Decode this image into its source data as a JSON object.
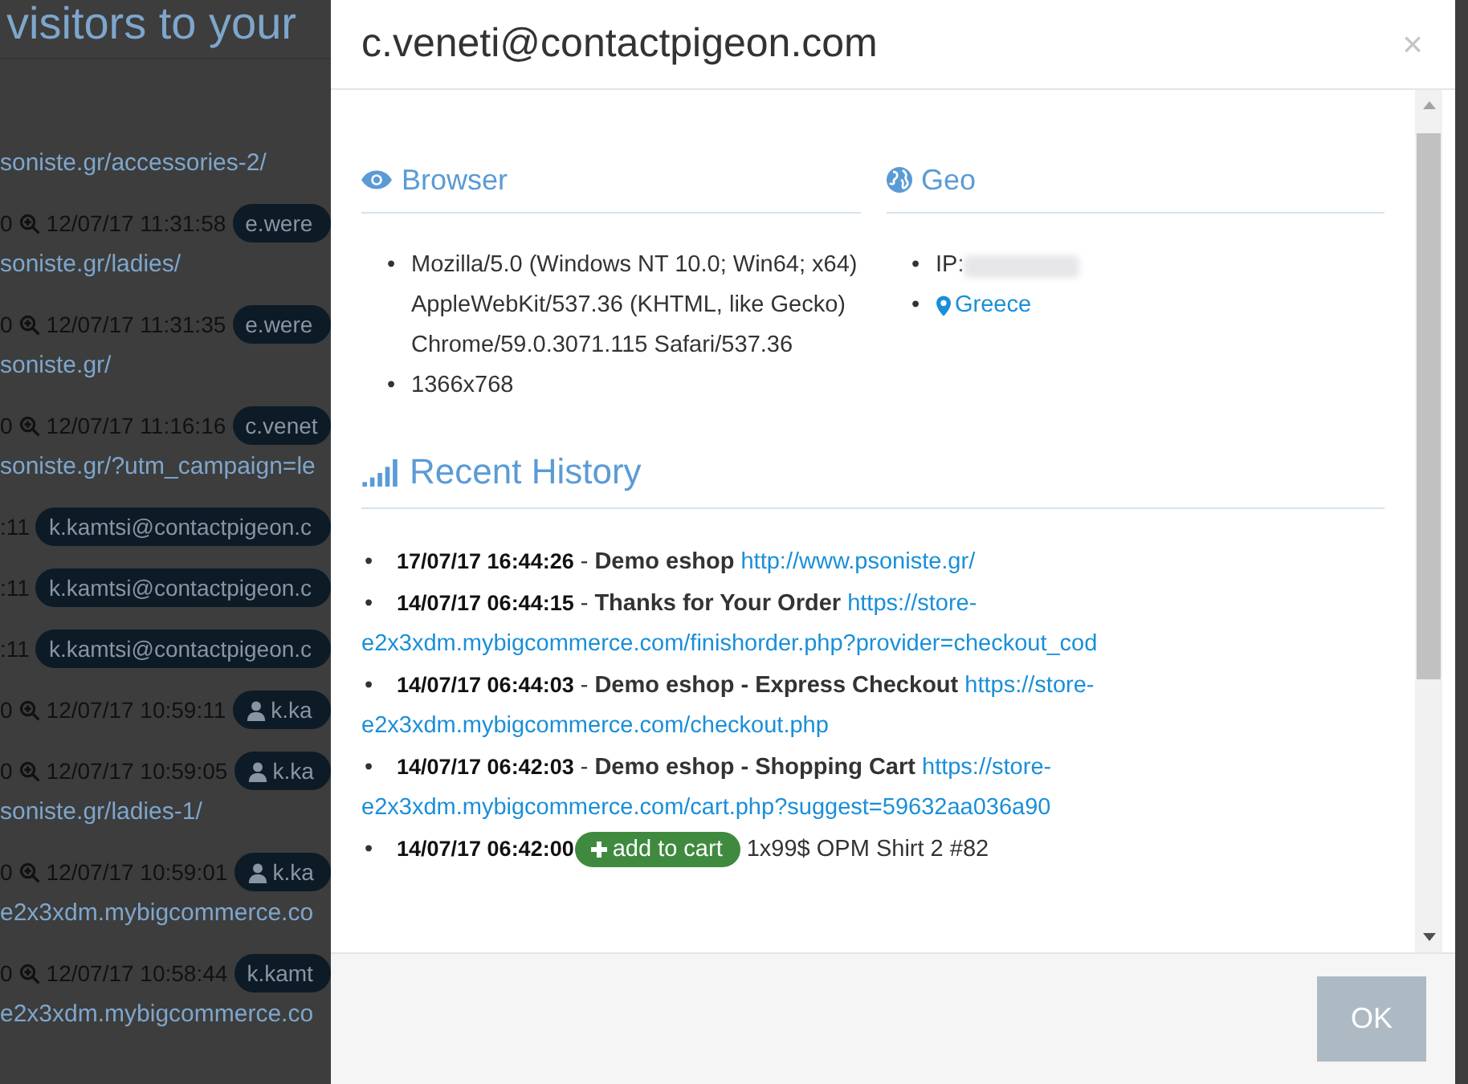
{
  "background": {
    "heading": "visitors to your",
    "rows": [
      {
        "kind": "link",
        "text": "soniste.gr/accessories-2/"
      },
      {
        "kind": "visit",
        "prefix": "0",
        "time": "12/07/17 11:31:58",
        "user": "e.were"
      },
      {
        "kind": "link",
        "text": "soniste.gr/ladies/"
      },
      {
        "kind": "visit",
        "prefix": "0",
        "time": "12/07/17 11:31:35",
        "user": "e.were"
      },
      {
        "kind": "link",
        "text": "soniste.gr/"
      },
      {
        "kind": "visit",
        "prefix": "0",
        "time": "12/07/17 11:16:16",
        "user": "c.venet"
      },
      {
        "kind": "link",
        "text": "soniste.gr/?utm_campaign=le"
      },
      {
        "kind": "user",
        "prefix": ":11",
        "user": "k.kamtsi@contactpigeon.c"
      },
      {
        "kind": "user",
        "prefix": ":11",
        "user": "k.kamtsi@contactpigeon.c"
      },
      {
        "kind": "user",
        "prefix": ":11",
        "user": "k.kamtsi@contactpigeon.c"
      },
      {
        "kind": "visit_icon",
        "prefix": "0",
        "time": "12/07/17 10:59:11",
        "user": "k.ka"
      },
      {
        "kind": "visit_icon",
        "prefix": "0",
        "time": "12/07/17 10:59:05",
        "user": "k.ka"
      },
      {
        "kind": "link",
        "text": "soniste.gr/ladies-1/"
      },
      {
        "kind": "visit_icon",
        "prefix": "0",
        "time": "12/07/17 10:59:01",
        "user": "k.ka"
      },
      {
        "kind": "link",
        "text": "e2x3xdm.mybigcommerce.co"
      },
      {
        "kind": "visit",
        "prefix": "0",
        "time": "12/07/17 10:58:44",
        "user": "k.kamt"
      },
      {
        "kind": "link",
        "text": "e2x3xdm.mybigcommerce.co"
      }
    ]
  },
  "modal": {
    "title": "c.veneti@contactpigeon.com",
    "close": "×",
    "browser": {
      "heading": "Browser",
      "items": [
        {
          "bullet": "•",
          "text": "Mozilla/5.0 (Windows NT 10.0; Win64; x64) AppleWebKit/537.36 (KHTML, like Gecko) Chrome/59.0.3071.115 Safari/537.36"
        },
        {
          "bullet": "•",
          "text": "1366x768"
        }
      ]
    },
    "geo": {
      "heading": "Geo",
      "ip_bullet": "•",
      "ip_label": "IP:",
      "location_bullet": "•",
      "location": "Greece"
    },
    "history": {
      "heading": "Recent History",
      "items": [
        {
          "kind": "page",
          "bullet": "•",
          "time": "17/07/17 16:44:26",
          "separator": "-",
          "title": "Demo eshop",
          "url_lines": [
            "http://www.psoniste.gr/"
          ]
        },
        {
          "kind": "page",
          "bullet": "•",
          "time": "14/07/17 06:44:15",
          "separator": "-",
          "title": "Thanks for Your Order",
          "url_lines": [
            "https://store-",
            "e2x3xdm.mybigcommerce.com/finishorder.php?provider=checkout_cod"
          ]
        },
        {
          "kind": "page",
          "bullet": "•",
          "time": "14/07/17 06:44:03",
          "separator": "-",
          "title": "Demo eshop - Express Checkout",
          "url_lines": [
            "https://store-",
            "e2x3xdm.mybigcommerce.com/checkout.php"
          ]
        },
        {
          "kind": "page",
          "bullet": "•",
          "time": "14/07/17 06:42:03",
          "separator": "-",
          "title": "Demo eshop - Shopping Cart",
          "url_lines": [
            "https://store-",
            "e2x3xdm.mybigcommerce.com/cart.php?suggest=59632aa036a90"
          ]
        },
        {
          "kind": "event",
          "bullet": "•",
          "time": "14/07/17 06:42:00",
          "badge": "add to cart",
          "detail": "1x99$ OPM Shirt 2 #82"
        }
      ]
    },
    "ok_button": "OK"
  }
}
